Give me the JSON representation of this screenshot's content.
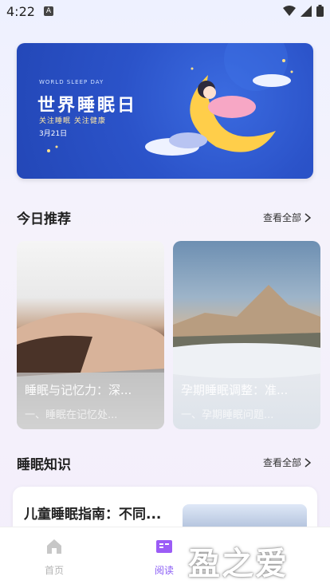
{
  "status": {
    "time": "4:22",
    "notif": "A"
  },
  "banner": {
    "sub": "WORLD SLEEP DAY",
    "title": "世界睡眠日",
    "slogan": "关注睡眠 关注健康",
    "date": "3月21日"
  },
  "recommend": {
    "title": "今日推荐",
    "view_all": "查看全部",
    "cards": [
      {
        "title": "睡眠与记忆力：深...",
        "summary": "一、睡眠在记忆处..."
      },
      {
        "title": "孕期睡眠调整：准...",
        "summary": "一、孕期睡眠问题..."
      }
    ]
  },
  "knowledge": {
    "title": "睡眠知识",
    "view_all": "查看全部",
    "articles": [
      {
        "title": "儿童睡眠指南：不同..."
      }
    ]
  },
  "tabs": [
    {
      "label": "首页",
      "active": false
    },
    {
      "label": "阅读",
      "active": true
    }
  ],
  "watermark": "盈之爱",
  "colors": {
    "accent": "#8a5cf5",
    "tab_inactive": "#b5b5b5"
  }
}
